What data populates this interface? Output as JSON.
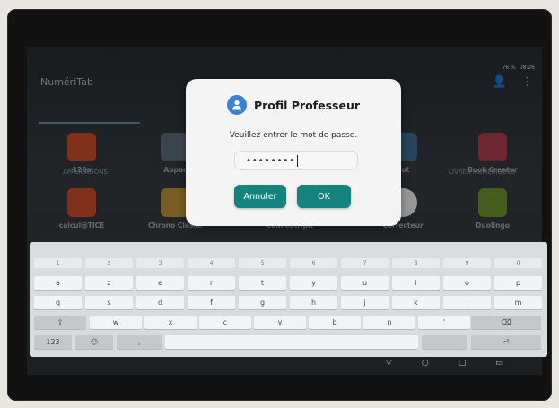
{
  "status": {
    "battery": "76 %",
    "time": "08:26"
  },
  "app": {
    "title": "NumériTab"
  },
  "tabs": [
    {
      "label": "APPLICATIONS"
    },
    {
      "label": "LIVRES NUMÉRIQUES"
    }
  ],
  "apps": {
    "row1": [
      "120s",
      "Appar",
      "Bot",
      "Book Creator"
    ],
    "row2": [
      "calcul@TICE",
      "Chrono Classe",
      "ComicStripIt",
      "Correcteur",
      "Duolingo"
    ]
  },
  "dialog": {
    "title": "Profil Professeur",
    "message": "Veuillez entrer le mot de passe.",
    "password_mask": "••••••••",
    "cancel_label": "Annuler",
    "ok_label": "OK"
  },
  "keyboard": {
    "numbers": [
      "1",
      "2",
      "3",
      "4",
      "5",
      "6",
      "7",
      "8",
      "9",
      "0"
    ],
    "row1": [
      "a",
      "z",
      "e",
      "r",
      "t",
      "y",
      "u",
      "i",
      "o",
      "p"
    ],
    "row2": [
      "q",
      "s",
      "d",
      "f",
      "g",
      "h",
      "j",
      "k",
      "l",
      "m"
    ],
    "row3": [
      "w",
      "x",
      "c",
      "v",
      "b",
      "n",
      "'"
    ],
    "mode_key": "123"
  },
  "colors": {
    "accent": "#17837f",
    "dialog_icon": "#3c7fd6"
  }
}
